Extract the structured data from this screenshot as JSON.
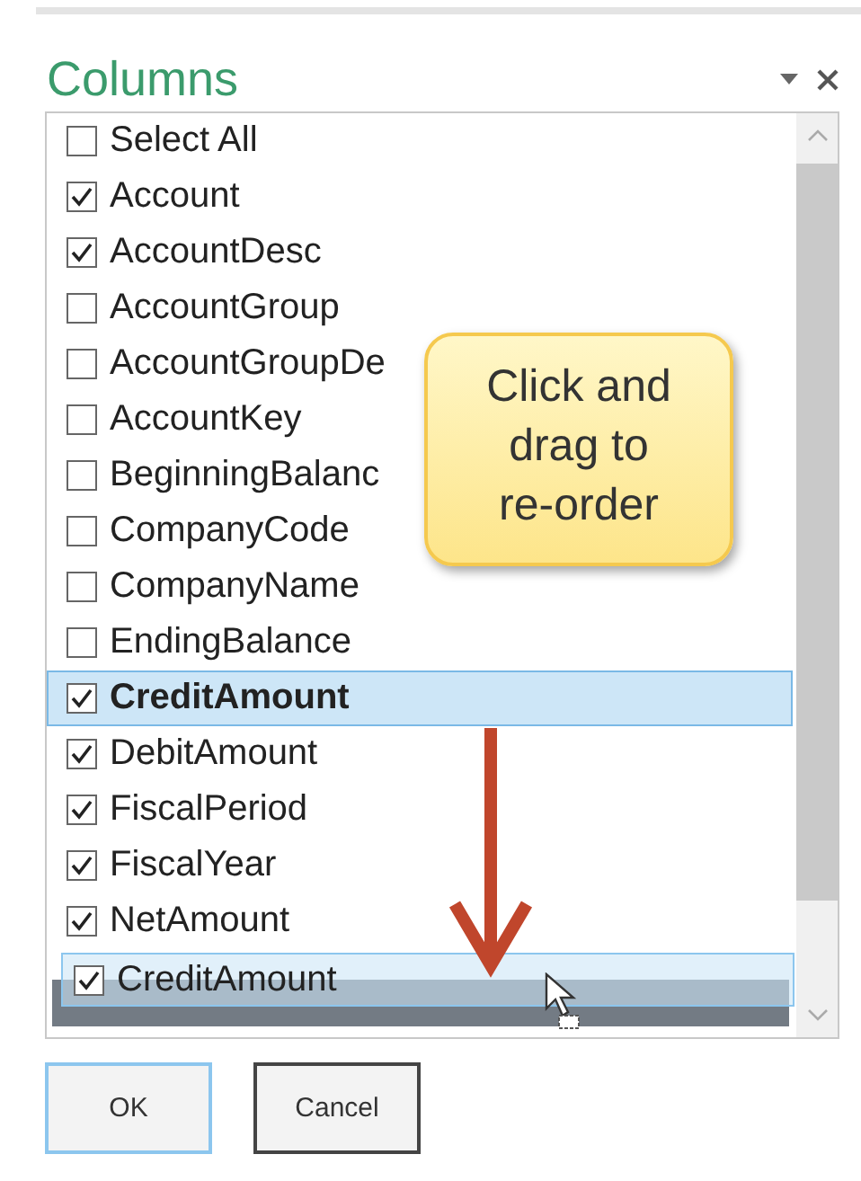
{
  "panel": {
    "title": "Columns"
  },
  "items": [
    {
      "label": "Select All",
      "checked": false,
      "selected": false
    },
    {
      "label": "Account",
      "checked": true,
      "selected": false
    },
    {
      "label": "AccountDesc",
      "checked": true,
      "selected": false
    },
    {
      "label": "AccountGroup",
      "checked": false,
      "selected": false
    },
    {
      "label": "AccountGroupDe",
      "checked": false,
      "selected": false
    },
    {
      "label": "AccountKey",
      "checked": false,
      "selected": false
    },
    {
      "label": "BeginningBalanc",
      "checked": false,
      "selected": false
    },
    {
      "label": "CompanyCode",
      "checked": false,
      "selected": false
    },
    {
      "label": "CompanyName",
      "checked": false,
      "selected": false
    },
    {
      "label": "EndingBalance",
      "checked": false,
      "selected": false
    },
    {
      "label": "CreditAmount",
      "checked": true,
      "selected": true
    },
    {
      "label": "DebitAmount",
      "checked": true,
      "selected": false
    },
    {
      "label": "FiscalPeriod",
      "checked": true,
      "selected": false
    },
    {
      "label": "FiscalYear",
      "checked": true,
      "selected": false
    },
    {
      "label": "NetAmount",
      "checked": true,
      "selected": false
    }
  ],
  "drag_ghost": {
    "label": "CreditAmount",
    "checked": true
  },
  "callout": {
    "text": "Click and\ndrag to\nre-order"
  },
  "buttons": [
    {
      "label": "OK",
      "selected": true
    },
    {
      "label": "Cancel",
      "selected": false
    }
  ]
}
